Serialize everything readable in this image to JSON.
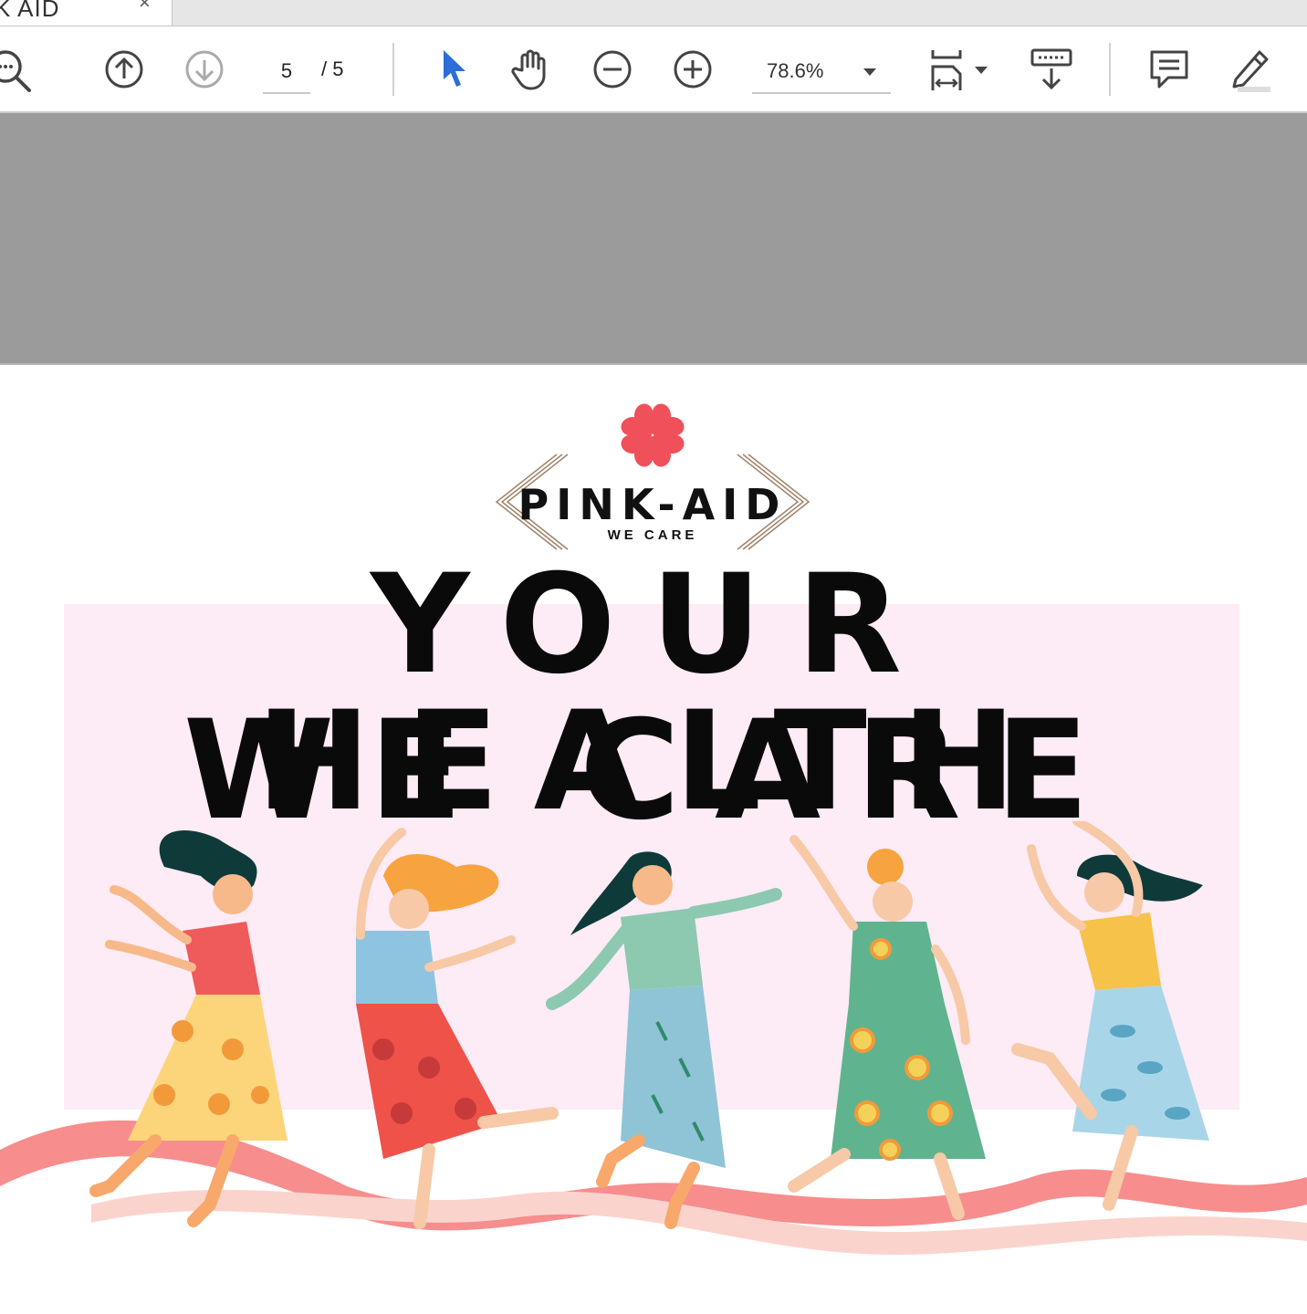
{
  "tab": {
    "title": "K AID",
    "close": "×"
  },
  "toolbar": {
    "page_current": "5",
    "page_total": "/ 5",
    "zoom": "78.6%"
  },
  "document": {
    "logo": {
      "name": "PINK-AID",
      "tagline": "WE CARE"
    },
    "headline_line1": "YOUR HEALTH",
    "headline_line2": "WE CARE"
  },
  "colors": {
    "accent": "#f0505a",
    "pink_band": "#fdebf5",
    "viewer_gap": "#9b9b9b",
    "select_tool": "#2b6fd6"
  },
  "icons": [
    "search-icon",
    "arrow-up-icon",
    "arrow-down-icon",
    "select-arrow-icon",
    "hand-icon",
    "zoom-out-icon",
    "zoom-in-icon",
    "fit-page-icon",
    "scroll-mode-icon",
    "comment-icon",
    "highlight-pen-icon"
  ]
}
